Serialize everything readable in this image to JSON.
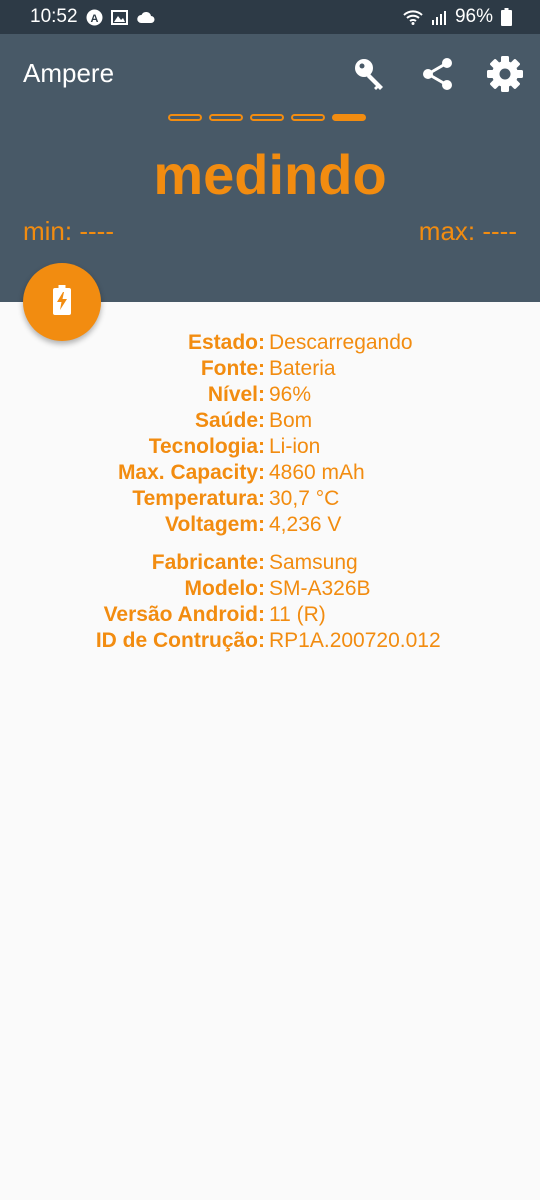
{
  "status_bar": {
    "time": "10:52",
    "battery_percent": "96%",
    "icons": [
      "a-circle-icon",
      "image-icon",
      "cloud-icon",
      "wifi-icon",
      "signal-icon",
      "battery-icon"
    ]
  },
  "app_bar": {
    "title": "Ampere",
    "actions": [
      "key-icon",
      "share-icon",
      "settings-icon"
    ]
  },
  "meter": {
    "value_text": "medindo",
    "min_text": "min: ----",
    "max_text": "max: ----",
    "indicator_count": 5,
    "active_indicator": 5
  },
  "colors": {
    "accent": "#f28c10",
    "header_bg": "#485967",
    "status_bg": "#2d3a46",
    "content_bg": "#fafafa"
  },
  "battery_info": [
    {
      "label": "Estado:",
      "value": "Descarregando"
    },
    {
      "label": "Fonte:",
      "value": "Bateria"
    },
    {
      "label": "Nível:",
      "value": "96%"
    },
    {
      "label": "Saúde:",
      "value": "Bom"
    },
    {
      "label": "Tecnologia:",
      "value": "Li-ion"
    },
    {
      "label": "Max. Capacity:",
      "value": "4860 mAh"
    },
    {
      "label": "Temperatura:",
      "value": "30,7 °C"
    },
    {
      "label": "Voltagem:",
      "value": "4,236 V"
    }
  ],
  "device_info": [
    {
      "label": "Fabricante:",
      "value": "Samsung"
    },
    {
      "label": "Modelo:",
      "value": "SM-A326B"
    },
    {
      "label": "Versão Android:",
      "value": "11 (R)"
    },
    {
      "label": "ID de Contrução:",
      "value": "RP1A.200720.012"
    }
  ]
}
